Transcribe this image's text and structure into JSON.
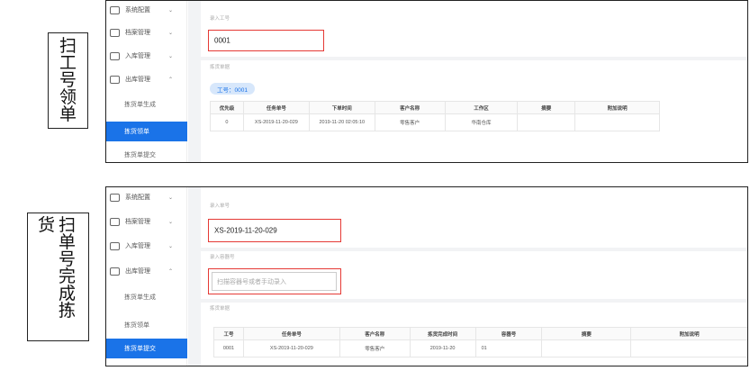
{
  "label1": {
    "chars": [
      "扫",
      "工",
      "号",
      "领",
      "单"
    ]
  },
  "label2": {
    "col_main": [
      "扫",
      "单",
      "号",
      "完",
      "成",
      "拣"
    ],
    "col_side": [
      "货"
    ]
  },
  "menu": {
    "system": "系统配置",
    "archive": "档案管理",
    "inbound": "入库管理",
    "outbound": "出库管理",
    "generate": "拣货单生成",
    "claim": "拣货领单",
    "submit": "拣货单提交"
  },
  "shot1": {
    "input_label": "录入工号",
    "input_value": "0001",
    "section_label": "拣货单据",
    "tag": "工号：0001",
    "columns": [
      "优先级",
      "任务单号",
      "下单时间",
      "客户名称",
      "工作区",
      "摘要",
      "附加说明"
    ],
    "rows": [
      [
        "0",
        "XS-2019-11-20-029",
        "2019-11-20 02:05:10",
        "零售客户",
        "华南仓库",
        "",
        ""
      ]
    ]
  },
  "shot2": {
    "input_label": "录入单号",
    "input_value": "XS-2019-11-20-029",
    "container_label": "录入容器号",
    "container_placeholder": "扫描容器号或者手动录入",
    "section_label": "拣货单据",
    "columns": [
      "工号",
      "任务单号",
      "客户名称",
      "拣货完成时间",
      "容器号",
      "摘要",
      "附加说明"
    ],
    "rows": [
      [
        "0001",
        "XS-2019-11-20-029",
        "零售客户",
        "2019-11-20",
        "01",
        "",
        ""
      ]
    ]
  }
}
